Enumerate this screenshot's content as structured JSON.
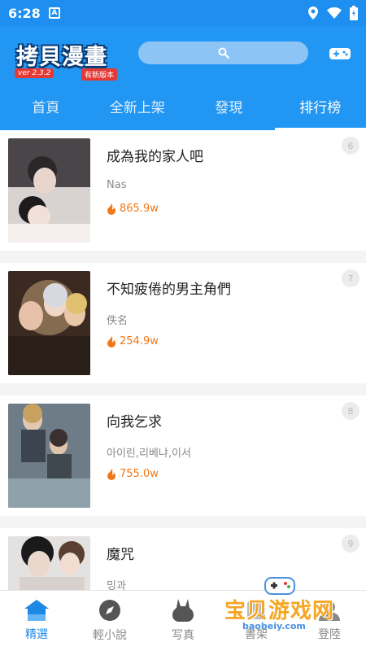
{
  "status_bar": {
    "time": "6:28",
    "badge": "A"
  },
  "header": {
    "logo_title": "拷貝漫畫",
    "logo_version": "ver 2.3.2",
    "logo_new_version": "有新版本"
  },
  "tabs": [
    {
      "label": "首頁",
      "active": false
    },
    {
      "label": "全新上架",
      "active": false
    },
    {
      "label": "發現",
      "active": false
    },
    {
      "label": "排行榜",
      "active": true
    }
  ],
  "comics": [
    {
      "rank": "6",
      "title": "成為我的家人吧",
      "author": "Nas",
      "views": "865.9w"
    },
    {
      "rank": "7",
      "title": "不知疲倦的男主角們",
      "author": "佚名",
      "views": "254.9w"
    },
    {
      "rank": "8",
      "title": "向我乞求",
      "author": "아이린,리베냐,이서",
      "views": "755.0w"
    },
    {
      "rank": "9",
      "title": "魔咒",
      "author": "밍과",
      "views": ""
    }
  ],
  "bottom_nav": [
    {
      "label": "精選",
      "active": true
    },
    {
      "label": "輕小說",
      "active": false
    },
    {
      "label": "写真",
      "active": false
    },
    {
      "label": "書架",
      "active": false
    },
    {
      "label": "登陸",
      "active": false
    }
  ],
  "watermark": {
    "text": "宝贝游戏网",
    "url": "baobeiy.com"
  },
  "colors": {
    "primary": "#2196f3",
    "accent": "#f07818",
    "nav_active": "#1e88e5"
  }
}
